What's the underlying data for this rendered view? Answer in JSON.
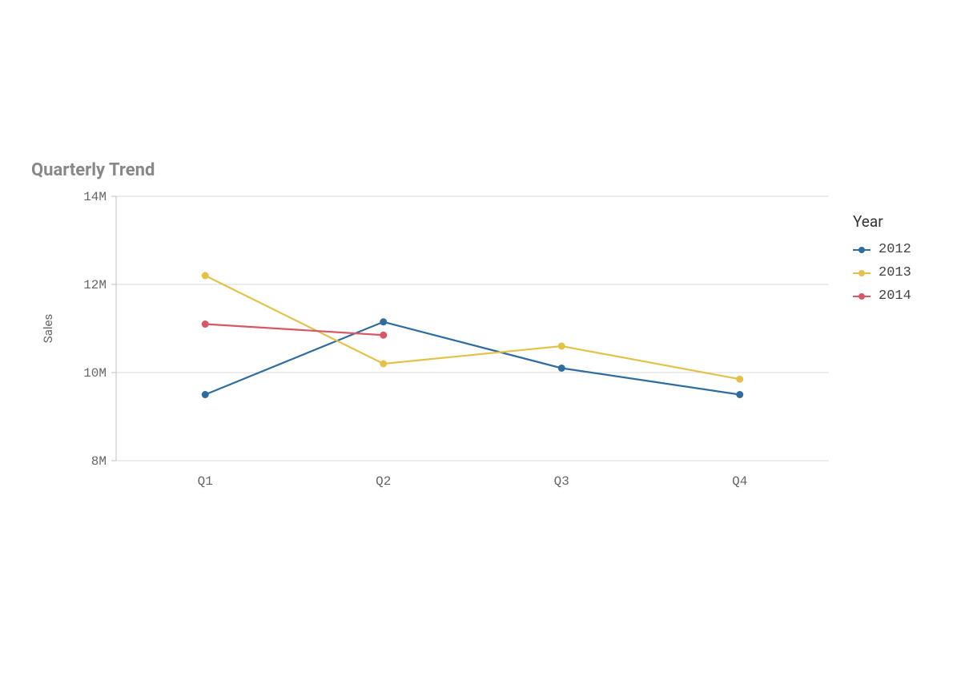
{
  "chart_data": {
    "type": "line",
    "title": "Quarterly Trend",
    "ylabel": "Sales",
    "xlabel": "",
    "categories": [
      "Q1",
      "Q2",
      "Q3",
      "Q4"
    ],
    "y_ticks": [
      8000000,
      10000000,
      12000000,
      14000000
    ],
    "y_tick_labels": [
      "8M",
      "10M",
      "12M",
      "14M"
    ],
    "ylim": [
      8000000,
      14000000
    ],
    "legend_title": "Year",
    "series": [
      {
        "name": "2012",
        "color": "#2f6c9f",
        "values": [
          9500000,
          11150000,
          10100000,
          9500000
        ]
      },
      {
        "name": "2013",
        "color": "#e3c24a",
        "values": [
          12200000,
          10200000,
          10600000,
          9850000
        ]
      },
      {
        "name": "2014",
        "color": "#d85765",
        "values": [
          11100000,
          10850000,
          null,
          null
        ]
      }
    ]
  }
}
